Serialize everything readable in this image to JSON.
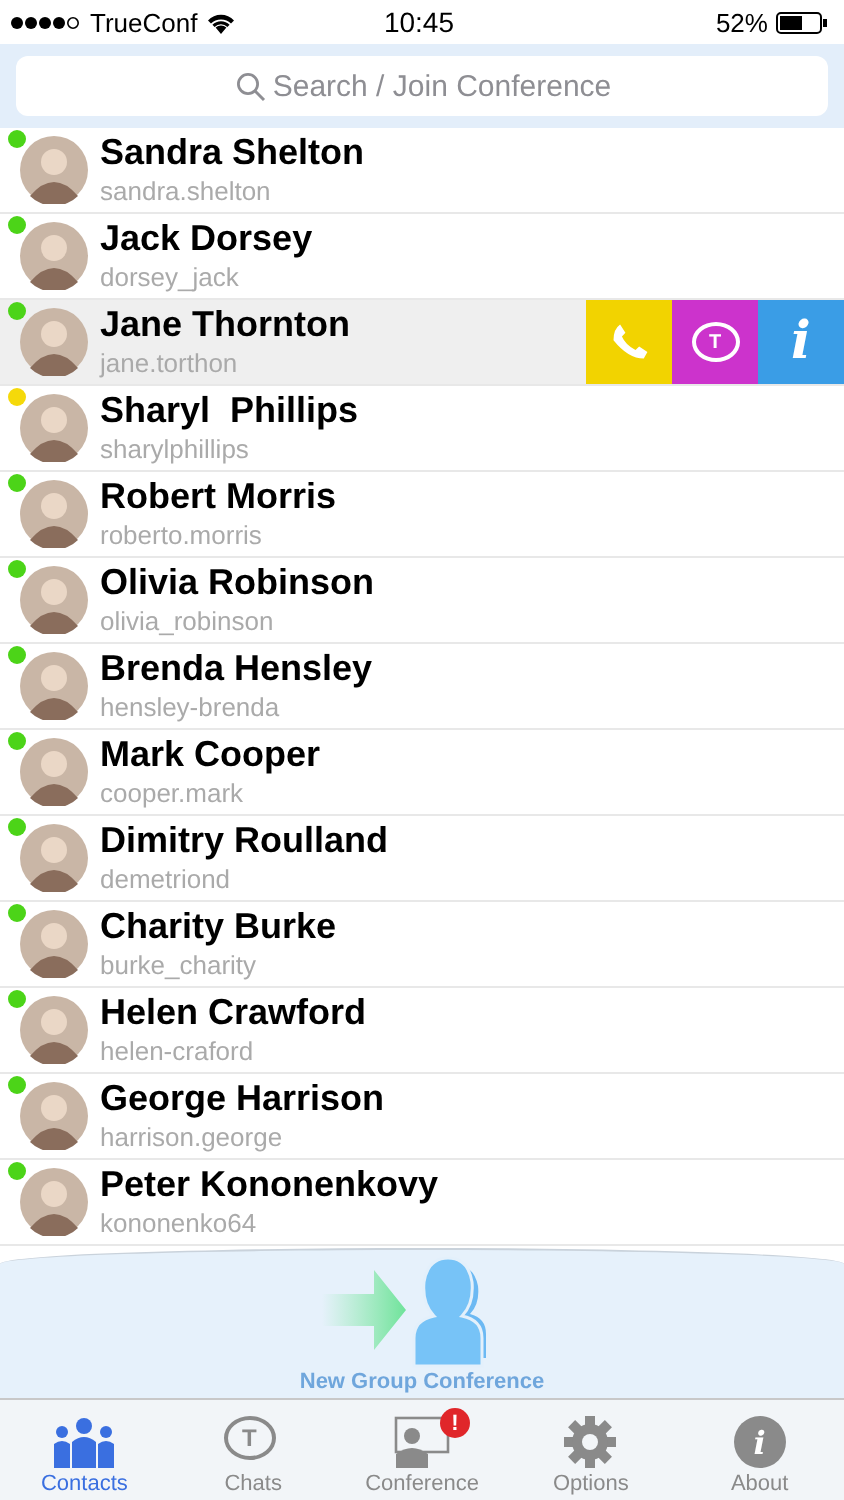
{
  "status_bar": {
    "carrier": "TrueConf",
    "time": "10:45",
    "battery": "52%"
  },
  "search": {
    "placeholder": "Search / Join Conference"
  },
  "contacts": [
    {
      "name": "Sandra Shelton",
      "username": "sandra.shelton",
      "color": "#4cd418",
      "swiped": false
    },
    {
      "name": "Jack Dorsey",
      "username": "dorsey_jack",
      "color": "#4cd418",
      "swiped": false
    },
    {
      "name": "Jane Thornton",
      "username": "jane.torthon",
      "color": "#4cd418",
      "swiped": true
    },
    {
      "name": "Sharyl  Phillips",
      "username": "sharylphillips",
      "color": "#f5d90a",
      "swiped": false
    },
    {
      "name": "Robert Morris",
      "username": "roberto.morris",
      "color": "#4cd418",
      "swiped": false
    },
    {
      "name": "Olivia Robinson",
      "username": "olivia_robinson",
      "color": "#4cd418",
      "swiped": false
    },
    {
      "name": "Brenda Hensley",
      "username": "hensley-brenda",
      "color": "#4cd418",
      "swiped": false
    },
    {
      "name": "Mark Cooper",
      "username": "cooper.mark",
      "color": "#4cd418",
      "swiped": false
    },
    {
      "name": "Dimitry Roulland",
      "username": "demetriond",
      "color": "#4cd418",
      "swiped": false
    },
    {
      "name": "Charity Burke",
      "username": "burke_charity",
      "color": "#4cd418",
      "swiped": false
    },
    {
      "name": "Helen Crawford",
      "username": "helen-craford",
      "color": "#4cd418",
      "swiped": false
    },
    {
      "name": "George Harrison",
      "username": "harrison.george",
      "color": "#4cd418",
      "swiped": false
    },
    {
      "name": "Peter Kononenkovy",
      "username": "kononenko64",
      "color": "#4cd418",
      "swiped": false
    }
  ],
  "row_actions": [
    {
      "kind": "call"
    },
    {
      "kind": "chat",
      "glyph": "T"
    },
    {
      "kind": "info",
      "glyph": "i"
    }
  ],
  "new_group": {
    "label": "New Group Conference"
  },
  "tabs": [
    {
      "kind": "contacts",
      "label": "Contacts",
      "selected": true
    },
    {
      "kind": "chats",
      "label": "Chats",
      "glyph": "T",
      "selected": false
    },
    {
      "kind": "conference",
      "label": "Conference",
      "badge": "!",
      "selected": false
    },
    {
      "kind": "options",
      "label": "Options",
      "selected": false
    },
    {
      "kind": "about",
      "label": "About",
      "glyph": "i",
      "selected": false
    }
  ]
}
